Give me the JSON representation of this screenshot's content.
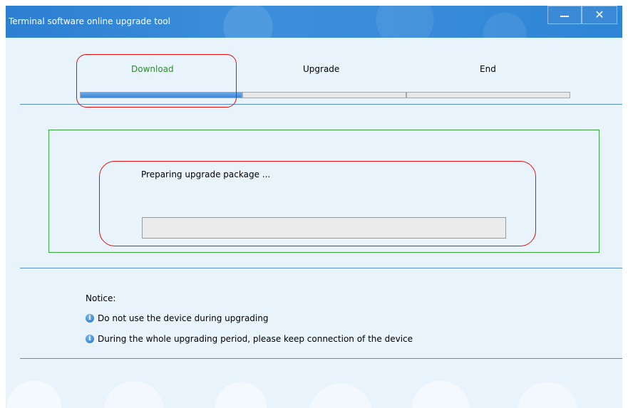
{
  "window": {
    "title": "Terminal software online upgrade tool",
    "minimize_icon": "minimize-icon",
    "close_icon": "close-icon",
    "close_glyph": "✕"
  },
  "steps": [
    {
      "label": "Download",
      "progress": 1.0,
      "active": true
    },
    {
      "label": "Upgrade",
      "progress": 0.0,
      "active": false
    },
    {
      "label": "End",
      "progress": 0.0,
      "active": false
    }
  ],
  "status": {
    "message": "Preparing upgrade package ...",
    "progress": 0.0
  },
  "notice": {
    "title": "Notice:",
    "items": [
      {
        "icon": "info-icon",
        "text": "Do not use the device during upgrading"
      },
      {
        "icon": "info-icon",
        "text": "During the whole upgrading period, please keep connection of the device"
      }
    ]
  },
  "colors": {
    "titlebar": "#2c7fd1",
    "active_step": "#2e8b2e",
    "progress_fill": "#3f86d6",
    "annotation": "#e01010",
    "group_border": "#3aa83a"
  }
}
